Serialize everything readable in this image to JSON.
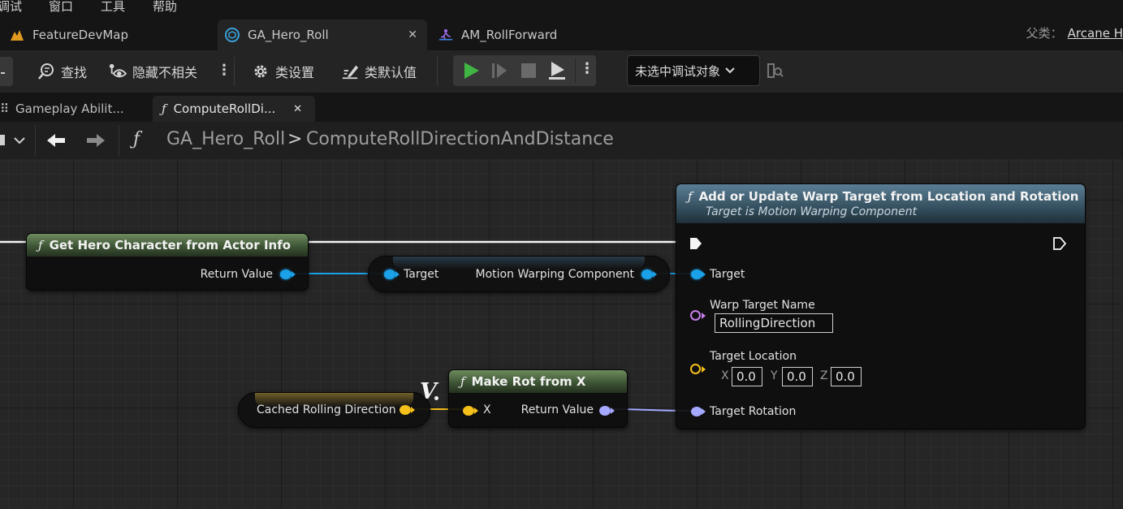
{
  "menu": {
    "items": [
      "调试",
      "窗口",
      "工具",
      "帮助"
    ]
  },
  "doc_tabs": [
    {
      "label": "FeatureDevMap",
      "icon": "level-icon",
      "color": "#e09b20"
    },
    {
      "label": "GA_Hero_Roll",
      "icon": "blueprint-icon",
      "active": true,
      "color": "#3aa0d8"
    },
    {
      "label": "AM_RollForward",
      "icon": "montage-icon",
      "color": "#9a6ae6"
    }
  ],
  "parent_class": {
    "label": "父类：",
    "value": "Arcane H"
  },
  "toolbar": {
    "find_label": "查找",
    "hide_unrelated_label": "隐藏不相关",
    "class_settings_label": "类设置",
    "class_defaults_label": "类默认值",
    "debug_object_label": "未选中调试对象",
    "play_color": "#40b544"
  },
  "graph_tabs": [
    {
      "label": "Gameplay Abilit..."
    },
    {
      "label": "ComputeRollDi...",
      "active": true
    }
  ],
  "breadcrumb": {
    "root": "GA_Hero_Roll",
    "separator": ">",
    "current": "ComputeRollDirectionAndDistance"
  },
  "nodes": {
    "get_hero": {
      "title": "Get Hero Character from Actor Info",
      "return_label": "Return Value"
    },
    "target_getter": {
      "input_label": "Target",
      "output_label": "Motion Warping Component"
    },
    "add_warp": {
      "title": "Add or Update Warp Target from Location and Rotation",
      "subtitle": "Target is Motion Warping Component",
      "target_label": "Target",
      "warp_name_label": "Warp Target Name",
      "warp_name_value": "RollingDirection",
      "location_label": "Target Location",
      "loc_x_label": "X",
      "loc_x": "0.0",
      "loc_y_label": "Y",
      "loc_y": "0.0",
      "loc_z_label": "Z",
      "loc_z": "0.0",
      "rotation_label": "Target Rotation"
    },
    "cached_var": {
      "label": "Cached Rolling Direction",
      "badge": "V"
    },
    "make_rot": {
      "title": "Make Rot from X",
      "input_label": "X",
      "return_label": "Return Value"
    }
  },
  "colors": {
    "object_pin": "#1aa1e8",
    "vector_pin": "#f5c01a",
    "rotator_pin": "#a4a8ff",
    "name_pin": "#c67ee8",
    "exec": "#ffffff"
  }
}
